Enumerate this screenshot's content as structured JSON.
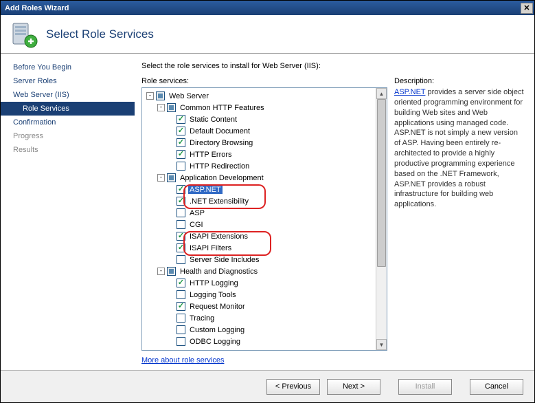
{
  "window": {
    "title": "Add Roles Wizard"
  },
  "header": {
    "title": "Select Role Services"
  },
  "sidebar": {
    "steps": [
      {
        "label": "Before You Begin"
      },
      {
        "label": "Server Roles"
      },
      {
        "label": "Web Server (IIS)"
      },
      {
        "label": "Role Services",
        "sub": true,
        "active": true
      },
      {
        "label": "Confirmation"
      },
      {
        "label": "Progress",
        "disabled": true
      },
      {
        "label": "Results",
        "disabled": true
      }
    ]
  },
  "main": {
    "instruction": "Select the role services to install for Web Server (IIS):",
    "tree_label": "Role services:",
    "desc_label": "Description:",
    "more_link": "More about role services",
    "desc_link": "ASP.NET",
    "desc_rest": " provides a server side object oriented programming environment for building Web sites and Web applications using managed code. ASP.NET is not simply a new version of ASP. Having been entirely re-architected to provide a highly productive programming experience based on the .NET Framework, ASP.NET provides a robust infrastructure for building web applications."
  },
  "tree": [
    {
      "level": 0,
      "exp": "-",
      "state": "gray",
      "label": "Web Server"
    },
    {
      "level": 1,
      "exp": "-",
      "state": "gray",
      "label": "Common HTTP Features"
    },
    {
      "level": 2,
      "state": "checked",
      "label": "Static Content"
    },
    {
      "level": 2,
      "state": "checked",
      "label": "Default Document"
    },
    {
      "level": 2,
      "state": "checked",
      "label": "Directory Browsing"
    },
    {
      "level": 2,
      "state": "checked",
      "label": "HTTP Errors"
    },
    {
      "level": 2,
      "state": "unchecked",
      "label": "HTTP Redirection"
    },
    {
      "level": 1,
      "exp": "-",
      "state": "gray",
      "label": "Application Development"
    },
    {
      "level": 2,
      "state": "checked",
      "label": "ASP.NET",
      "selected": true
    },
    {
      "level": 2,
      "state": "checked",
      "label": ".NET Extensibility"
    },
    {
      "level": 2,
      "state": "unchecked",
      "label": "ASP"
    },
    {
      "level": 2,
      "state": "unchecked",
      "label": "CGI"
    },
    {
      "level": 2,
      "state": "checked",
      "label": "ISAPI Extensions"
    },
    {
      "level": 2,
      "state": "checked",
      "label": "ISAPI Filters"
    },
    {
      "level": 2,
      "state": "unchecked",
      "label": "Server Side Includes"
    },
    {
      "level": 1,
      "exp": "-",
      "state": "gray",
      "label": "Health and Diagnostics"
    },
    {
      "level": 2,
      "state": "checked",
      "label": "HTTP Logging"
    },
    {
      "level": 2,
      "state": "unchecked",
      "label": "Logging Tools"
    },
    {
      "level": 2,
      "state": "checked",
      "label": "Request Monitor"
    },
    {
      "level": 2,
      "state": "unchecked",
      "label": "Tracing"
    },
    {
      "level": 2,
      "state": "unchecked",
      "label": "Custom Logging"
    },
    {
      "level": 2,
      "state": "unchecked",
      "label": "ODBC Logging"
    }
  ],
  "buttons": {
    "prev": "< Previous",
    "next": "Next >",
    "install": "Install",
    "cancel": "Cancel"
  }
}
